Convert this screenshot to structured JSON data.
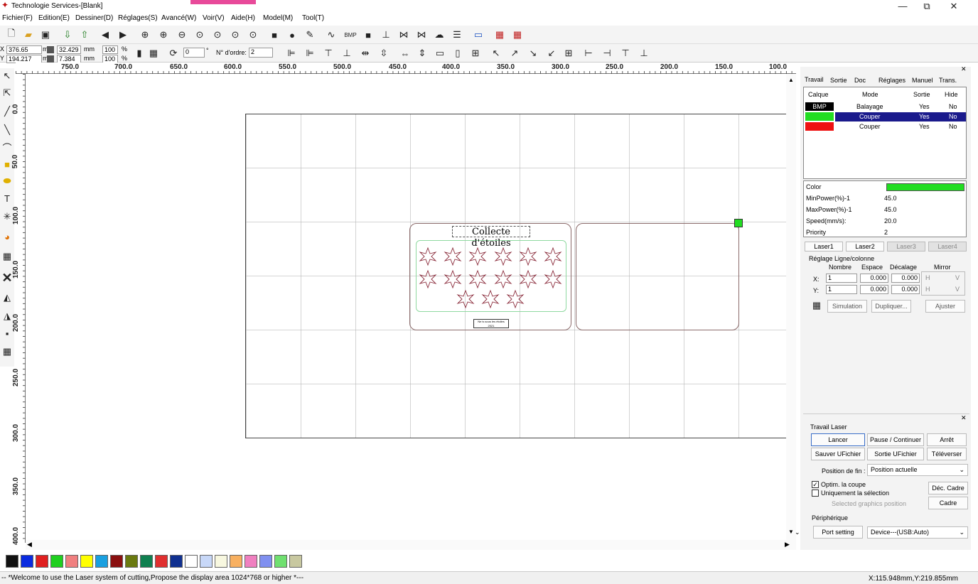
{
  "window": {
    "title": "Technologie Services-[Blank]",
    "min": "—",
    "max": "⧉",
    "close": "✕"
  },
  "menu": [
    "Fichier(F)",
    "Edition(E)",
    "Dessiner(D)",
    "Réglages(S)",
    "Avancé(W)",
    "Voir(V)",
    "Aide(H)",
    "Model(M)",
    "Tool(T)"
  ],
  "coords": {
    "x_label": "X",
    "y_label": "Y",
    "x": "376.65",
    "y": "194.217",
    "unit": "mm",
    "w": "32.429",
    "h": "7.384",
    "pct1": "100",
    "pct2": "100",
    "pct": "%",
    "rotation": "0",
    "deg": "°",
    "order_label": "N° d'ordre:",
    "order": "2"
  },
  "ruler_top": [
    "750.0",
    "700.0",
    "650.0",
    "600.0",
    "550.0",
    "500.0",
    "450.0",
    "400.0",
    "350.0",
    "300.0",
    "250.0",
    "200.0",
    "150.0",
    "100.0"
  ],
  "ruler_left": [
    "0.0",
    "50.0",
    "100.0",
    "150.0",
    "200.0",
    "250.0",
    "300.0",
    "350.0",
    "400.0"
  ],
  "design": {
    "title": "Collecte d'étoiles",
    "footer_line1": "Ne is sous les étoiles",
    "footer_line2": "2021"
  },
  "palette": [
    "#111111",
    "#0a2be0",
    "#e02020",
    "#20d020",
    "#f08080",
    "#ffff00",
    "#1aa0e0",
    "#8a1010",
    "#6a7a10",
    "#108050",
    "#e03030",
    "#103090",
    "#ffffff",
    "#c8d8f8",
    "#f8f8e0",
    "#f8b060",
    "#f080c0",
    "#8090f0",
    "#70e070",
    "#c8c8a0"
  ],
  "status": {
    "message": "-- *Welcome to use the Laser system of cutting,Propose the display area 1024*768 or higher *---",
    "coords": "X:115.948mm,Y:219.855mm"
  },
  "panel": {
    "tabs": [
      "Travail",
      "Sortie",
      "Doc",
      "Réglages",
      "Manuel",
      "Trans."
    ],
    "layer_headers": [
      "Calque",
      "Mode",
      "Sortie",
      "Hide"
    ],
    "layers": [
      {
        "name": "BMP",
        "mode": "Balayage",
        "out": "Yes",
        "hide": "No",
        "color": "#000000"
      },
      {
        "name": "",
        "mode": "Couper",
        "out": "Yes",
        "hide": "No",
        "color": "#22dd22"
      },
      {
        "name": "",
        "mode": "Couper",
        "out": "Yes",
        "hide": "No",
        "color": "#ee1111"
      }
    ],
    "props": [
      {
        "k": "Color",
        "v": ""
      },
      {
        "k": "MinPower(%)-1",
        "v": "45.0"
      },
      {
        "k": "MaxPower(%)-1",
        "v": "45.0"
      },
      {
        "k": "Speed(mm/s):",
        "v": "20.0"
      },
      {
        "k": "Priority",
        "v": "2"
      }
    ],
    "lasers": [
      "Laser1",
      "Laser2",
      "Laser3",
      "Laser4"
    ],
    "array": {
      "title": "Réglage Ligne/colonne",
      "h1": "Nombre",
      "h2": "Espace",
      "h3": "Décalage",
      "h4": "Mirror",
      "x": "X:",
      "y": "Y:",
      "xn": "1",
      "xs": "0.000",
      "xd": "0.000",
      "yn": "1",
      "ys": "0.000",
      "yd": "0.000",
      "mh": "H",
      "mv": "V"
    },
    "sim": "Simulation",
    "dup": "Dupliquer...",
    "adj": "Ajuster",
    "job_title": "Travail Laser",
    "start": "Lancer",
    "pause": "Pause / Continuer",
    "stop": "Arrêt",
    "save_file": "Sauver UFichier",
    "out_file": "Sortie UFichier",
    "upload": "Téléverser",
    "end_label": "Position de fin :",
    "end_value": "Position actuelle",
    "opt_cut": "Optim. la coupe",
    "sel_only": "Uniquement la sélection",
    "sel_graphics": "Selected graphics position",
    "dec_cadre": "Déc. Cadre",
    "cadre": "Cadre",
    "periph": "Périphérique",
    "port": "Port setting",
    "device": "Device---(USB:Auto)"
  },
  "colors": {
    "selected_row": "#1a1a8c",
    "accent_green": "#22dd22"
  }
}
